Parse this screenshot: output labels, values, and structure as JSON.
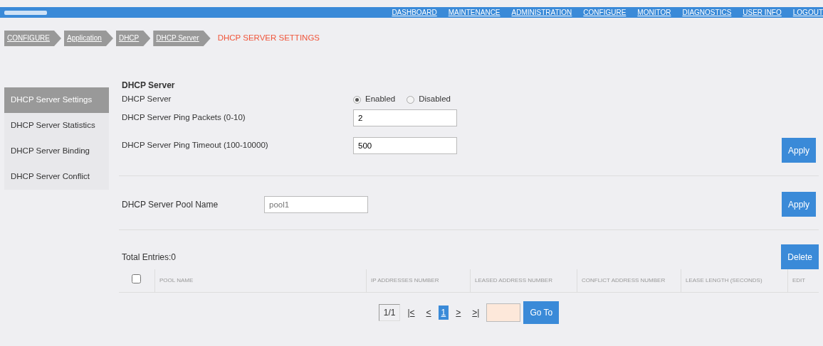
{
  "top_nav": {
    "items": [
      "DASHBOARD",
      "MAINTENANCE",
      "ADMINISTRATION",
      "CONFIGURE",
      "MONITOR",
      "DIAGNOSTICS",
      "USER INFO",
      "LOGOUT"
    ]
  },
  "breadcrumb": [
    {
      "label": "CONFIGURE",
      "current": false
    },
    {
      "label": "Application",
      "current": false
    },
    {
      "label": "DHCP",
      "current": false
    },
    {
      "label": "DHCP Server",
      "current": false
    },
    {
      "label": "DHCP SERVER SETTINGS",
      "current": true
    }
  ],
  "sidebar": {
    "items": [
      {
        "label": "DHCP Server Settings",
        "selected": true
      },
      {
        "label": "DHCP Server Statistics",
        "selected": false
      },
      {
        "label": "DHCP Server Binding",
        "selected": false
      },
      {
        "label": "DHCP Server Conflict",
        "selected": false
      }
    ]
  },
  "settings": {
    "title": "DHCP Server",
    "rows": [
      {
        "kind": "radio",
        "label": "DHCP Server",
        "options": [
          {
            "label": "Enabled",
            "selected": true
          },
          {
            "label": "Disabled",
            "selected": false
          }
        ]
      },
      {
        "kind": "input",
        "label": "DHCP Server Ping Packets (0-10)",
        "value": "2"
      },
      {
        "kind": "input",
        "label": "DHCP Server Ping Timeout (100-10000)",
        "value": "500"
      }
    ],
    "apply": "Apply"
  },
  "pool": {
    "label": "DHCP Server Pool Name",
    "placeholder": "pool1",
    "apply": "Apply"
  },
  "table": {
    "total": "Total Entries:0",
    "delete": "Delete",
    "select_all": {
      "checked": false
    },
    "columns": [
      "POOL NAME",
      "IP ADDRESSES NUMBER",
      "LEASED ADDRESS NUMBER",
      "CONFLICT ADDRESS NUMBER",
      "LEASE LENGTH (SECONDS)",
      "EDIT"
    ]
  },
  "pagination": {
    "page_info": "1/1",
    "first": "|<",
    "prev": "<",
    "pages": [
      {
        "label": "1",
        "selected": true
      }
    ],
    "next": ">",
    "last": ">|",
    "goto": "Go To"
  }
}
